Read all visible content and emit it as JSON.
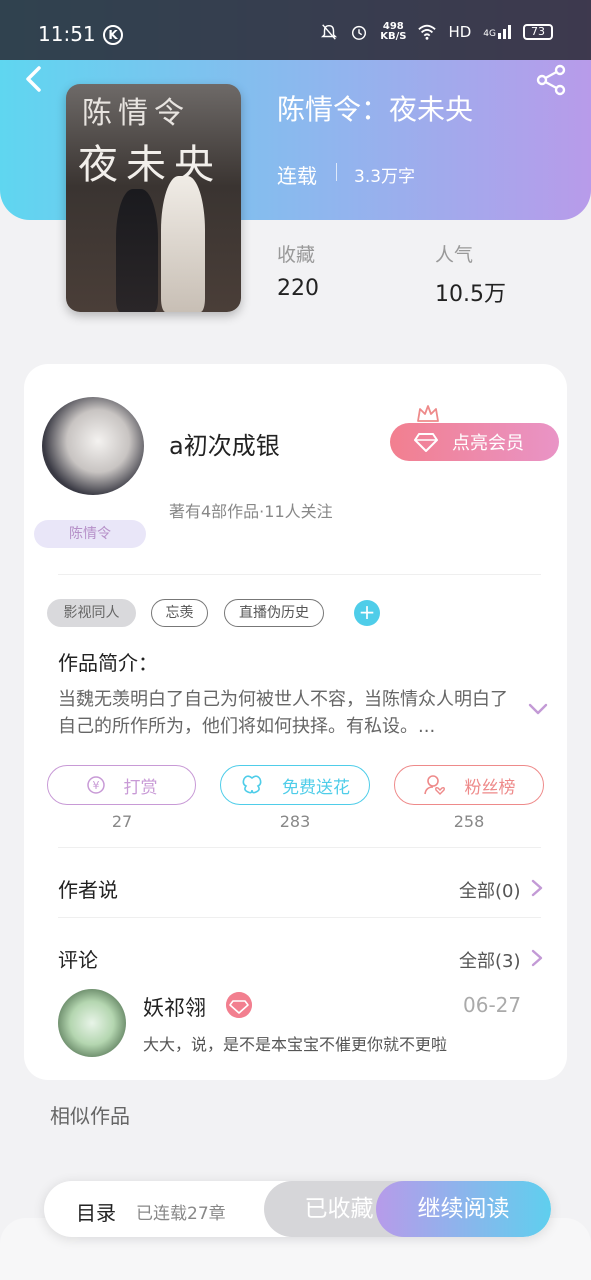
{
  "status_bar": {
    "time": "11:51",
    "k_badge": "K",
    "net_speed_value": "498",
    "net_speed_unit": "KB/S",
    "hd": "HD",
    "signal": "4G",
    "battery": "73"
  },
  "header": {
    "back_icon": "chevron-left-icon",
    "share_icon": "share-icon",
    "cover_text_line1": "陈情令",
    "cover_text_line2": "夜未央"
  },
  "book": {
    "title": "陈情令：夜未央",
    "status": "连载",
    "word_count": "3.3万字",
    "favorites_label": "收藏",
    "favorites_value": "220",
    "popularity_label": "人气",
    "popularity_value": "10.5万"
  },
  "author": {
    "name": "a初次成银",
    "info": "著有4部作品·11人关注",
    "badge": "陈情令",
    "vip_button": "点亮会员"
  },
  "tags": [
    "影视同人",
    "忘羡",
    "直播伪历史"
  ],
  "synopsis": {
    "title": "作品简介：",
    "text": "当魏无羡明白了自己为何被世人不容，当陈情众人明白了自己的所作所为，他们将如何抉择。有私设。..."
  },
  "actions": [
    {
      "label": "打赏",
      "count": "27",
      "color": "#c89ad6"
    },
    {
      "label": "免费送花",
      "count": "283",
      "color": "#4fcde9"
    },
    {
      "label": "粉丝榜",
      "count": "258",
      "color": "#ee8a8a"
    }
  ],
  "author_says": {
    "title": "作者说",
    "more": "全部(0)"
  },
  "comments": {
    "title": "评论",
    "more": "全部(3)",
    "items": [
      {
        "user": "妖祁翎",
        "date": "06-27",
        "text": "大大，说，是不是本宝宝不催更你就不更啦"
      }
    ]
  },
  "similar": {
    "title": "相似作品"
  },
  "bottom_bar": {
    "toc": "目录",
    "chapters": "已连载27章",
    "collected": "已收藏",
    "continue": "继续阅读"
  }
}
